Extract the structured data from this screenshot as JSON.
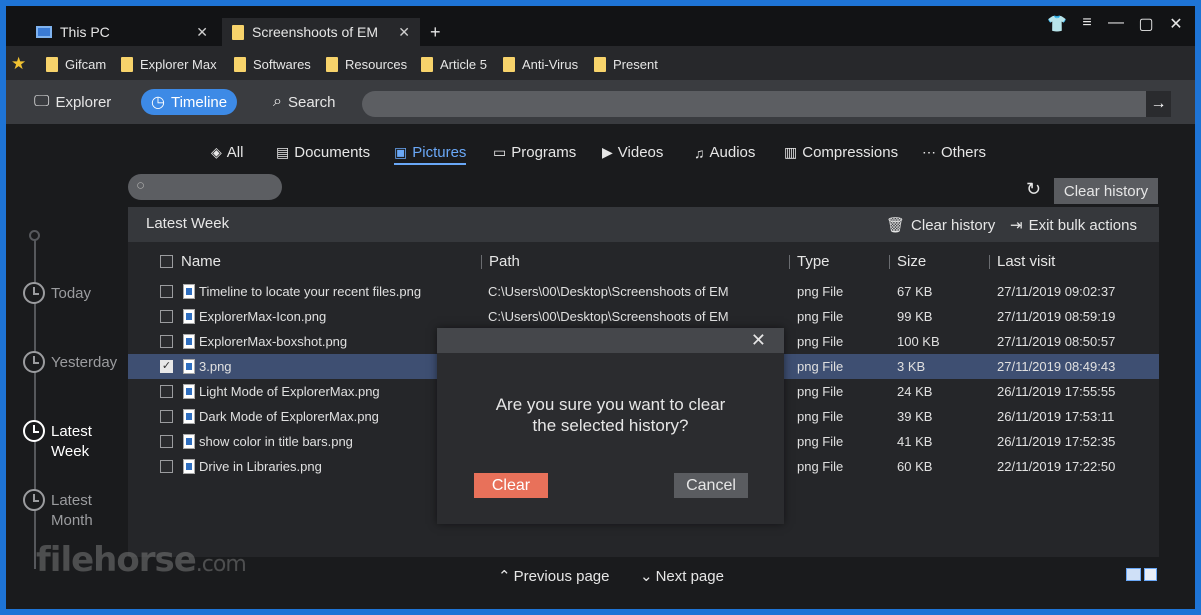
{
  "tabs": [
    {
      "label": "This PC",
      "icon": "computer-icon",
      "active": false
    },
    {
      "label": "Screenshoots of EM",
      "icon": "folder-icon",
      "active": true
    }
  ],
  "window_controls": [
    "shirt-icon",
    "menu-icon",
    "minimize-icon",
    "maximize-icon",
    "close-icon"
  ],
  "bookmarks": [
    "Gifcam",
    "Explorer Max",
    "Softwares",
    "Resources",
    "Article 5",
    "Anti-Virus",
    "Present"
  ],
  "nav": {
    "explorer": "Explorer",
    "timeline": "Timeline",
    "search": "Search",
    "address_value": ""
  },
  "categories": [
    {
      "label": "All",
      "icon": "layers-icon"
    },
    {
      "label": "Documents",
      "icon": "document-icon"
    },
    {
      "label": "Pictures",
      "icon": "picture-icon",
      "active": true
    },
    {
      "label": "Programs",
      "icon": "programs-icon"
    },
    {
      "label": "Videos",
      "icon": "video-icon"
    },
    {
      "label": "Audios",
      "icon": "music-icon"
    },
    {
      "label": "Compressions",
      "icon": "archive-icon"
    },
    {
      "label": "Others",
      "icon": "others-icon"
    }
  ],
  "toolbar": {
    "filter_value": "",
    "clear_history": "Clear history"
  },
  "timeline": [
    {
      "label": "Today",
      "active": false
    },
    {
      "label": "Yesterday",
      "active": false
    },
    {
      "label": "Latest Week",
      "active": true
    },
    {
      "label": "Latest Month",
      "active": false
    }
  ],
  "panel": {
    "title": "Latest Week",
    "clear_history": "Clear history",
    "exit_bulk": "Exit bulk actions",
    "columns": {
      "name": "Name",
      "path": "Path",
      "type": "Type",
      "size": "Size",
      "last_visit": "Last visit"
    },
    "rows": [
      {
        "name": "Timeline to locate your recent files.png",
        "path": "C:\\Users\\00\\Desktop\\Screenshoots of EM",
        "type": "png File",
        "size": "67 KB",
        "last_visit": "27/11/2019 09:02:37",
        "checked": false
      },
      {
        "name": "ExplorerMax-Icon.png",
        "path": "C:\\Users\\00\\Desktop\\Screenshoots of EM",
        "type": "png File",
        "size": "99 KB",
        "last_visit": "27/11/2019 08:59:19",
        "checked": false
      },
      {
        "name": "ExplorerMax-boxshot.png",
        "path": "",
        "type": "png File",
        "size": "100 KB",
        "last_visit": "27/11/2019 08:50:57",
        "checked": false
      },
      {
        "name": "3.png",
        "path": "",
        "type": "png File",
        "size": "3 KB",
        "last_visit": "27/11/2019 08:49:43",
        "checked": true
      },
      {
        "name": "Light Mode of ExplorerMax.png",
        "path": "",
        "type": "png File",
        "size": "24 KB",
        "last_visit": "26/11/2019 17:55:55",
        "checked": false
      },
      {
        "name": "Dark Mode of ExplorerMax.png",
        "path": "",
        "type": "png File",
        "size": "39 KB",
        "last_visit": "26/11/2019 17:53:11",
        "checked": false
      },
      {
        "name": "show color in title bars.png",
        "path": "",
        "type": "png File",
        "size": "41 KB",
        "last_visit": "26/11/2019 17:52:35",
        "checked": false
      },
      {
        "name": "Drive in Libraries.png",
        "path": "",
        "type": "png File",
        "size": "60 KB",
        "last_visit": "22/11/2019 17:22:50",
        "checked": false
      }
    ]
  },
  "pager": {
    "prev": "Previous page",
    "next": "Next page"
  },
  "watermark": {
    "text": "filehorse",
    "suffix": ".com"
  },
  "modal": {
    "message_line1": "Are you sure you want to clear",
    "message_line2": "the selected history?",
    "confirm": "Clear",
    "cancel": "Cancel"
  },
  "colors": {
    "accent": "#3d8ae6",
    "confirm": "#e8715a",
    "selected_row": "#3e4f72",
    "frame": "#1e74d6"
  }
}
